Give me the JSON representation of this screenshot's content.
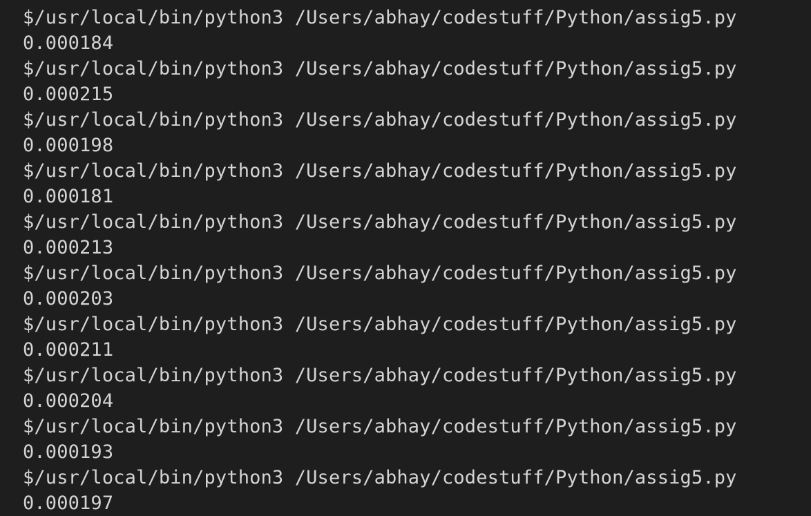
{
  "terminal": {
    "runs": [
      {
        "command": "$/usr/local/bin/python3 /Users/abhay/codestuff/Python/assig5.py",
        "output": "0.000184"
      },
      {
        "command": "$/usr/local/bin/python3 /Users/abhay/codestuff/Python/assig5.py",
        "output": "0.000215"
      },
      {
        "command": "$/usr/local/bin/python3 /Users/abhay/codestuff/Python/assig5.py",
        "output": "0.000198"
      },
      {
        "command": "$/usr/local/bin/python3 /Users/abhay/codestuff/Python/assig5.py",
        "output": "0.000181"
      },
      {
        "command": "$/usr/local/bin/python3 /Users/abhay/codestuff/Python/assig5.py",
        "output": "0.000213"
      },
      {
        "command": "$/usr/local/bin/python3 /Users/abhay/codestuff/Python/assig5.py",
        "output": "0.000203"
      },
      {
        "command": "$/usr/local/bin/python3 /Users/abhay/codestuff/Python/assig5.py",
        "output": "0.000211"
      },
      {
        "command": "$/usr/local/bin/python3 /Users/abhay/codestuff/Python/assig5.py",
        "output": "0.000204"
      },
      {
        "command": "$/usr/local/bin/python3 /Users/abhay/codestuff/Python/assig5.py",
        "output": "0.000193"
      },
      {
        "command": "$/usr/local/bin/python3 /Users/abhay/codestuff/Python/assig5.py",
        "output": "0.000197"
      }
    ],
    "colors": {
      "background": "#1e1e1e",
      "text": "#d4d4d4"
    }
  }
}
